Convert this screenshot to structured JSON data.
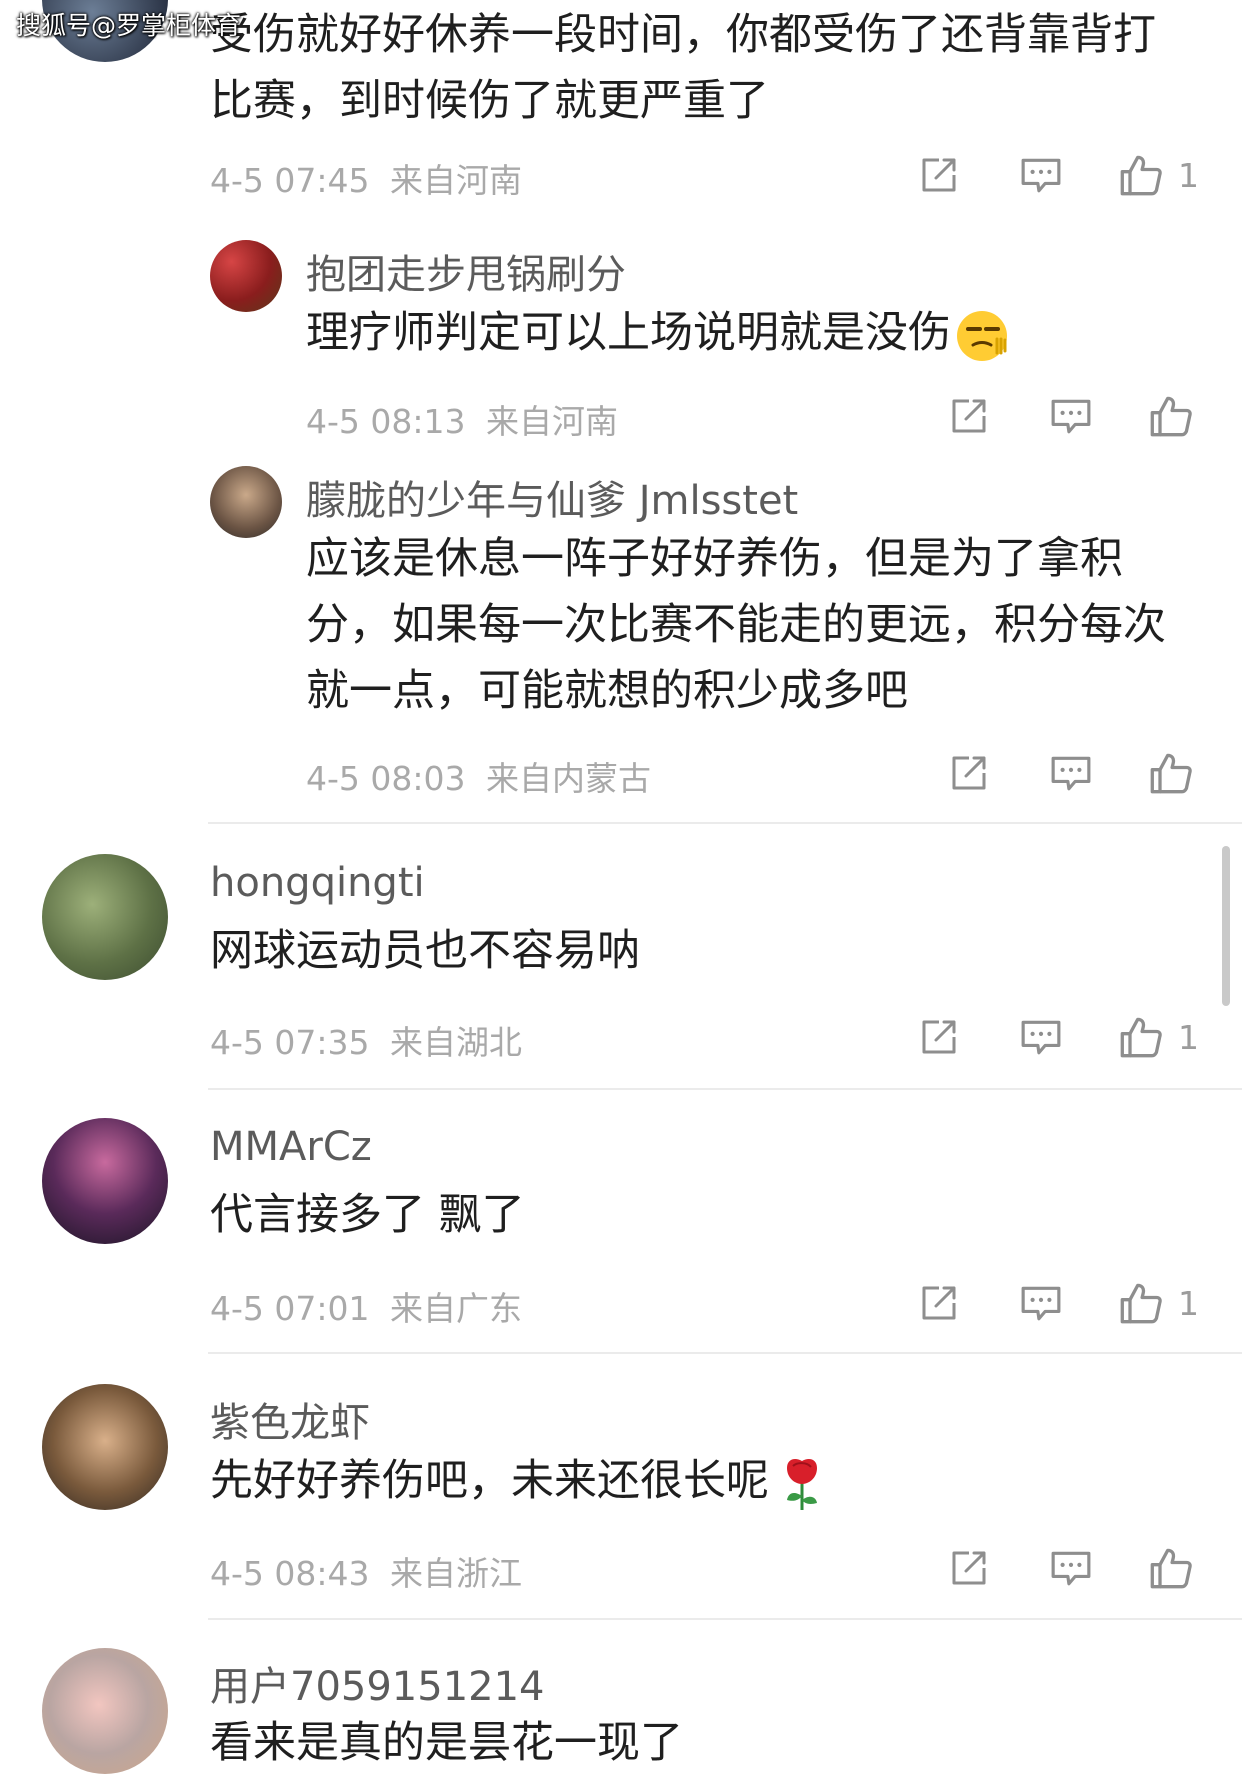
{
  "watermark": "搜狐号@罗掌柜体育",
  "comments": [
    {
      "content": "受伤就好好休养一段时间，你都受伤了还背靠背打比赛，到时候伤了就更严重了",
      "time": "4-5 07:45",
      "location": "来自河南",
      "likes": "1",
      "replies": [
        {
          "username": "抱团走步甩锅刷分",
          "content": "理疗师判定可以上场说明就是没伤",
          "emoji": "smirk-emoji",
          "time": "4-5 08:13",
          "location": "来自河南",
          "likes": ""
        },
        {
          "username": "朦胧的少年与仙爹 Jmlsstet",
          "content": "应该是休息一阵子好好养伤，但是为了拿积分，如果每一次比赛不能走的更远，积分每次就一点，可能就想的积少成多吧",
          "time": "4-5 08:03",
          "location": "来自内蒙古",
          "likes": ""
        }
      ]
    },
    {
      "username": "hongqingti",
      "content": "网球运动员也不容易呐",
      "time": "4-5 07:35",
      "location": "来自湖北",
      "likes": "1"
    },
    {
      "username": "MMArCz",
      "content": "代言接多了 飘了",
      "time": "4-5 07:01",
      "location": "来自广东",
      "likes": "1"
    },
    {
      "username": "紫色龙虾",
      "content": "先好好养伤吧，未来还很长呢",
      "emoji": "rose-emoji",
      "time": "4-5 08:43",
      "location": "来自浙江",
      "likes": ""
    },
    {
      "username": "用户7059151214",
      "content": "看来是真的是昙花一现了"
    }
  ],
  "icons": {
    "share": "share-icon",
    "reply": "comment-icon",
    "like": "thumbs-up-icon"
  },
  "colors": {
    "text": "#1f1f1f",
    "username": "#5b5b5b",
    "meta": "#a9a9a9",
    "icon": "#8e8e8e",
    "divider": "#ebebeb"
  }
}
